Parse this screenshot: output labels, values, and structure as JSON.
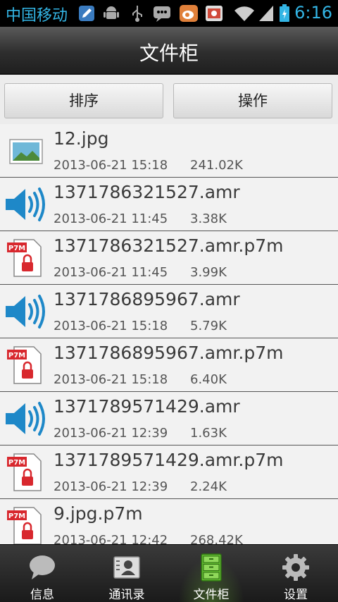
{
  "status_bar": {
    "carrier": "中国移动",
    "time": "6:16",
    "icons": [
      "pencil-app-icon",
      "android-debug-icon",
      "usb-icon",
      "chat-icon",
      "weibo-icon",
      "store-icon",
      "wifi-icon",
      "signal-icon",
      "battery-icon"
    ]
  },
  "header": {
    "title": "文件柜"
  },
  "toolbar": {
    "sort_label": "排序",
    "operate_label": "操作"
  },
  "files": [
    {
      "name": "12.jpg",
      "date": "2013-06-21 15:18",
      "size": "241.02K",
      "icon": "image-file-icon"
    },
    {
      "name": "1371786321527.amr",
      "date": "2013-06-21 11:45",
      "size": "3.38K",
      "icon": "audio-file-icon"
    },
    {
      "name": "1371786321527.amr.p7m",
      "date": "2013-06-21 11:45",
      "size": "3.99K",
      "icon": "p7m-locked-file-icon"
    },
    {
      "name": "1371786895967.amr",
      "date": "2013-06-21 15:18",
      "size": "5.79K",
      "icon": "audio-file-icon"
    },
    {
      "name": "1371786895967.amr.p7m",
      "date": "2013-06-21 15:18",
      "size": "6.40K",
      "icon": "p7m-locked-file-icon"
    },
    {
      "name": "1371789571429.amr",
      "date": "2013-06-21 12:39",
      "size": "1.63K",
      "icon": "audio-file-icon"
    },
    {
      "name": "1371789571429.amr.p7m",
      "date": "2013-06-21 12:39",
      "size": "2.24K",
      "icon": "p7m-locked-file-icon"
    },
    {
      "name": "9.jpg.p7m",
      "date": "2013-06-21 12:42",
      "size": "268.42K",
      "icon": "p7m-locked-file-icon"
    }
  ],
  "p7m_badge": "P7M",
  "bottom_nav": [
    {
      "label": "信息",
      "icon": "speech-bubble-icon",
      "active": false
    },
    {
      "label": "通讯录",
      "icon": "contact-card-icon",
      "active": false
    },
    {
      "label": "文件柜",
      "icon": "file-cabinet-icon",
      "active": true
    },
    {
      "label": "设置",
      "icon": "gear-icon",
      "active": false
    }
  ],
  "colors": {
    "status_accent": "#33b5e5",
    "active_tab_glow": "#78c83c"
  }
}
